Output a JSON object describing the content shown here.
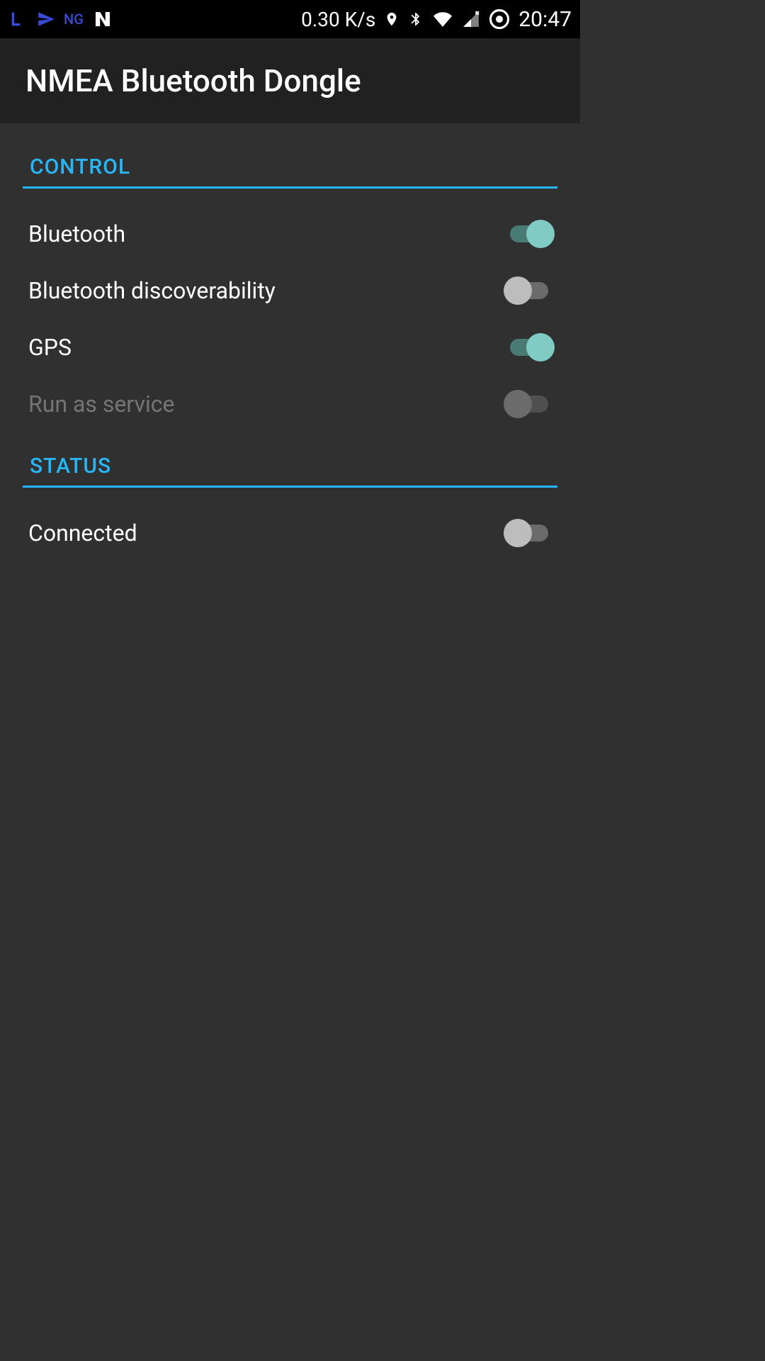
{
  "status_bar": {
    "ng": "NG",
    "data_speed": "0.30 K/s",
    "time": "20:47"
  },
  "header": {
    "title": "NMEA Bluetooth Dongle"
  },
  "sections": {
    "control": {
      "label": "CONTROL",
      "items": {
        "bluetooth": {
          "label": "Bluetooth",
          "on": true,
          "disabled": false
        },
        "bluetooth_disc": {
          "label": "Bluetooth discoverability",
          "on": false,
          "disabled": false
        },
        "gps": {
          "label": "GPS",
          "on": true,
          "disabled": false
        },
        "run_service": {
          "label": "Run as service",
          "on": false,
          "disabled": true
        }
      }
    },
    "status": {
      "label": "STATUS",
      "items": {
        "connected": {
          "label": "Connected",
          "on": false,
          "disabled": false
        }
      }
    }
  }
}
